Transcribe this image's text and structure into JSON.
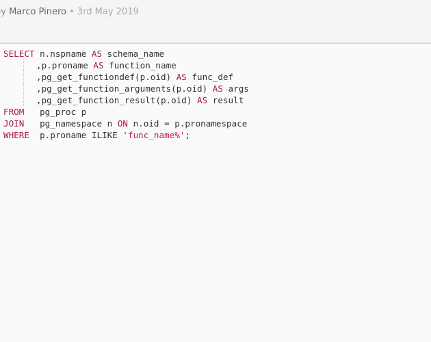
{
  "meta": {
    "by_prefix": "by ",
    "author": "Marco Pinero",
    "separator": " • ",
    "date": "3rd May 2019"
  },
  "code": {
    "language": "sql",
    "lines": [
      {
        "kw1": "SELECT",
        "t1": " n.nspname ",
        "kw2": "AS",
        "t2": " schema_name"
      },
      {
        "t1": ",p.proname ",
        "kw2": "AS",
        "t2": " function_name"
      },
      {
        "t1": ",pg_get_functiondef(p.oid) ",
        "kw2": "AS",
        "t2": " func_def"
      },
      {
        "t1": ",pg_get_function_arguments(p.oid) ",
        "kw2": "AS",
        "t2": " args"
      },
      {
        "t1": ",pg_get_function_result(p.oid) ",
        "kw2": "AS",
        "t2": " result"
      },
      {
        "kw1": "FROM",
        "t1": "   pg_proc p"
      },
      {
        "kw1": "JOIN",
        "t1": "   pg_namespace n ",
        "kw2": "ON",
        "t2": " n.oid = p.pronamespace"
      },
      {
        "kw1": "WHERE",
        "t1": "  p.proname ILIKE ",
        "str": "'func_name%'",
        "t3": ";"
      }
    ]
  }
}
